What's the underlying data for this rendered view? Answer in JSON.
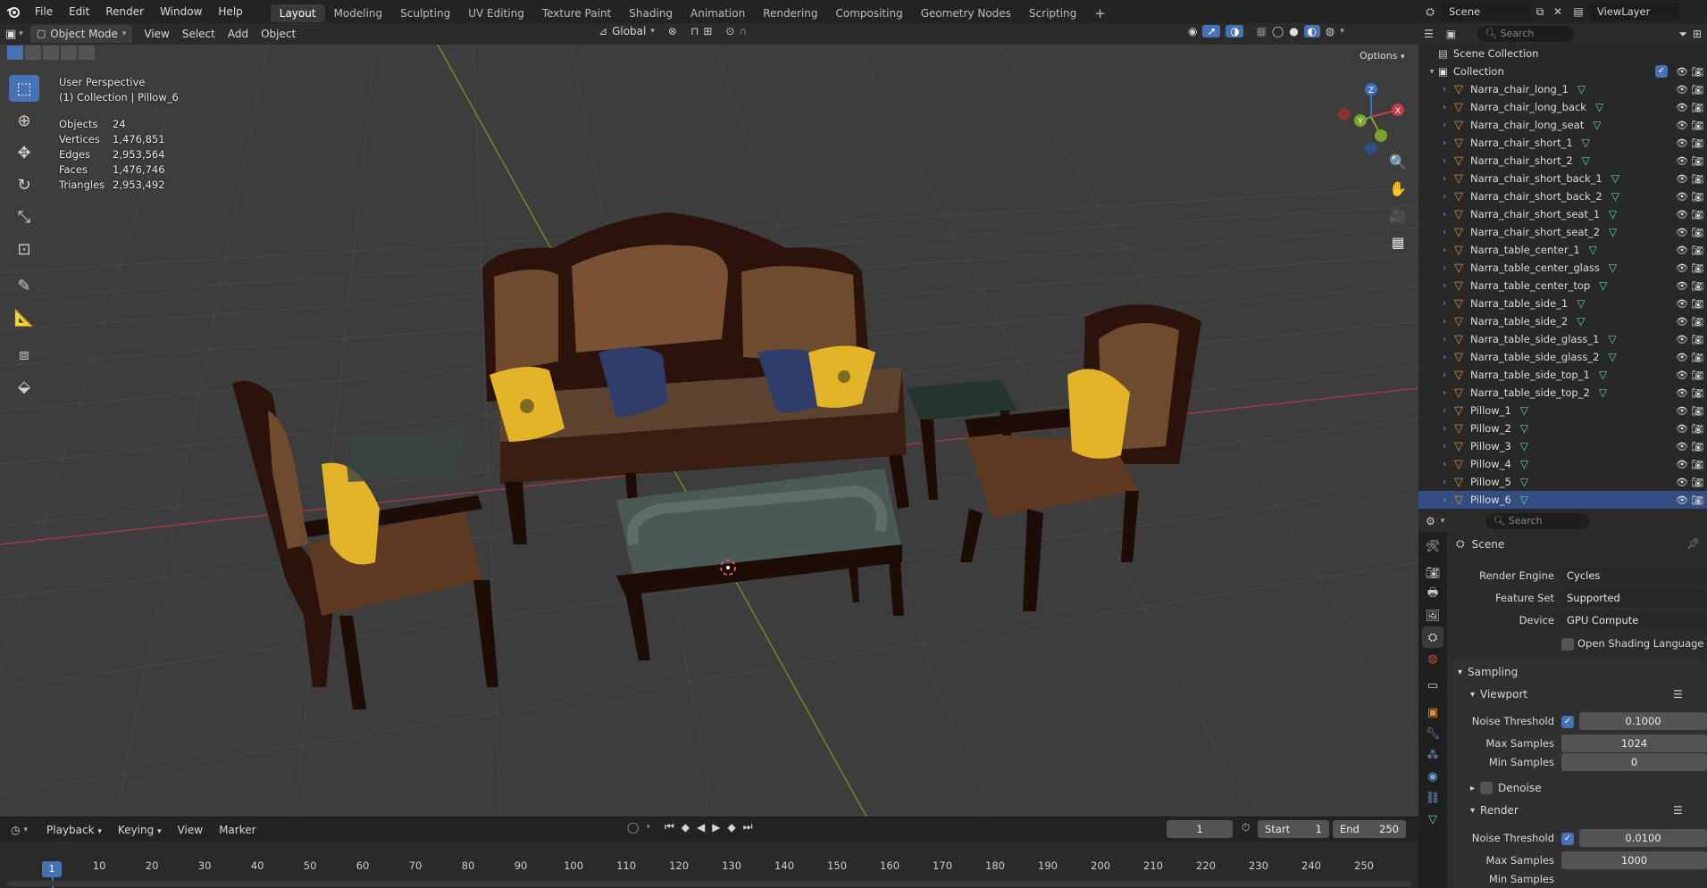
{
  "topbar": {
    "menus": [
      "File",
      "Edit",
      "Render",
      "Window",
      "Help"
    ],
    "workspaces": [
      "Layout",
      "Modeling",
      "Sculpting",
      "UV Editing",
      "Texture Paint",
      "Shading",
      "Animation",
      "Rendering",
      "Compositing",
      "Geometry Nodes",
      "Scripting"
    ],
    "active_workspace": "Layout",
    "add_tab": "+",
    "scene": "Scene",
    "view_layer": "ViewLayer"
  },
  "viewport_header": {
    "mode": "Object Mode",
    "menus": [
      "View",
      "Select",
      "Add",
      "Object"
    ],
    "orientation": "Global",
    "options": "Options"
  },
  "overlay": {
    "perspective": "User Perspective",
    "collection_line": "(1) Collection | Pillow_6",
    "stats": [
      {
        "label": "Objects",
        "value": "24"
      },
      {
        "label": "Vertices",
        "value": "1,476,851"
      },
      {
        "label": "Edges",
        "value": "2,953,564"
      },
      {
        "label": "Faces",
        "value": "1,476,746"
      },
      {
        "label": "Triangles",
        "value": "2,953,492"
      }
    ]
  },
  "gizmo": {
    "x": "X",
    "y": "Y",
    "z": "Z"
  },
  "outliner": {
    "search_placeholder": "Search",
    "scene_collection": "Scene Collection",
    "collection": "Collection",
    "items": [
      "Narra_chair_long_1",
      "Narra_chair_long_back",
      "Narra_chair_long_seat",
      "Narra_chair_short_1",
      "Narra_chair_short_2",
      "Narra_chair_short_back_1",
      "Narra_chair_short_back_2",
      "Narra_chair_short_seat_1",
      "Narra_chair_short_seat_2",
      "Narra_table_center_1",
      "Narra_table_center_glass",
      "Narra_table_center_top",
      "Narra_table_side_1",
      "Narra_table_side_2",
      "Narra_table_side_glass_1",
      "Narra_table_side_glass_2",
      "Narra_table_side_top_1",
      "Narra_table_side_top_2",
      "Pillow_1",
      "Pillow_2",
      "Pillow_3",
      "Pillow_4",
      "Pillow_5",
      "Pillow_6"
    ],
    "selected": "Pillow_6"
  },
  "properties": {
    "search_placeholder": "Search",
    "context": "Scene",
    "render_engine_label": "Render Engine",
    "render_engine": "Cycles",
    "feature_set_label": "Feature Set",
    "feature_set": "Supported",
    "device_label": "Device",
    "device": "GPU Compute",
    "osl_label": "Open Shading Language",
    "sampling": "Sampling",
    "viewport": "Viewport",
    "vp_noise_label": "Noise Threshold",
    "vp_noise": "0.1000",
    "vp_max_label": "Max Samples",
    "vp_max": "1024",
    "vp_min_label": "Min Samples",
    "vp_min": "0",
    "denoise": "Denoise",
    "render": "Render",
    "r_noise_label": "Noise Threshold",
    "r_noise": "0.0100",
    "r_max_label": "Max Samples",
    "r_max": "1000",
    "r_min_label": "Min Samples"
  },
  "timeline": {
    "menus": [
      "Playback",
      "Keying",
      "View",
      "Marker"
    ],
    "current_frame": "1",
    "start_label": "Start",
    "start": "1",
    "end_label": "End",
    "end": "250",
    "ticks": [
      "1",
      "10",
      "20",
      "30",
      "40",
      "50",
      "60",
      "70",
      "80",
      "90",
      "100",
      "110",
      "120",
      "130",
      "140",
      "150",
      "160",
      "170",
      "180",
      "190",
      "200",
      "210",
      "220",
      "230",
      "240",
      "250"
    ]
  },
  "colors": {
    "accent": "#4772b3",
    "x_axis": "#c83c46",
    "y_axis": "#7fa32f",
    "wood": "#3a1d12",
    "pillow_yellow": "#e3b428",
    "pillow_blue": "#2f3d6b"
  }
}
